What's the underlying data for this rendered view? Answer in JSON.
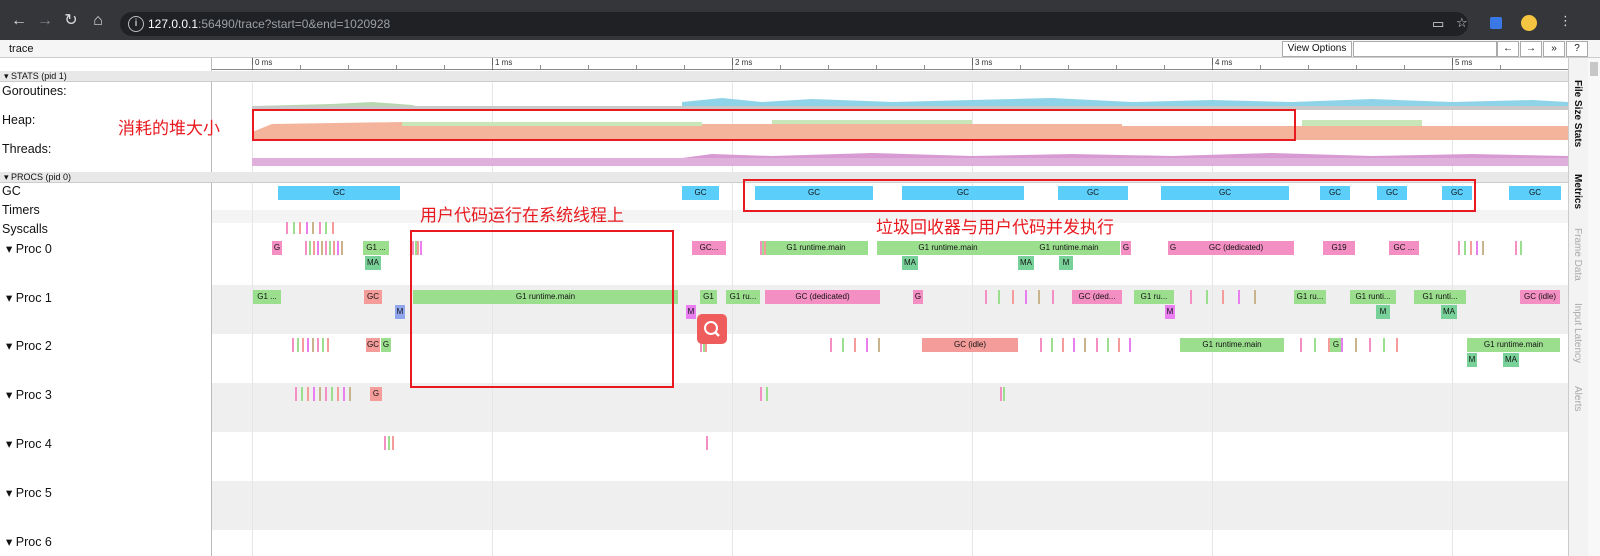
{
  "browser": {
    "url_host": "127.0.0.1",
    "url_rest": ":56490/trace?start=0&end=1020928",
    "nav_icons": [
      "back-arrow-icon",
      "forward-arrow-icon",
      "reload-icon",
      "home-icon"
    ]
  },
  "toolbar": {
    "title": "trace",
    "view_options": "View Options",
    "search_placeholder": "",
    "nav_prev": "←",
    "nav_next": "→",
    "nav_more": "»",
    "help": "?"
  },
  "ruler": {
    "labels": [
      "0 ms",
      "1 ms",
      "2 ms",
      "3 ms",
      "4 ms",
      "5 ms"
    ]
  },
  "sections": {
    "stats": "STATS (pid 1)",
    "procs": "PROCS (pid 0)"
  },
  "tracks": {
    "goroutines": "Goroutines:",
    "heap": "Heap:",
    "threads": "Threads:",
    "gc": "GC",
    "timers": "Timers",
    "syscalls": "Syscalls",
    "proc0": "Proc 0",
    "proc1": "Proc 1",
    "proc2": "Proc 2",
    "proc3": "Proc 3",
    "proc4": "Proc 4",
    "proc5": "Proc 5",
    "proc6": "Proc 6"
  },
  "slices": {
    "gc": [
      "GC",
      "GC",
      "GC",
      "GC",
      "GC",
      "GC",
      "GC",
      "GC",
      "GC",
      "GC"
    ],
    "p0": [
      "G",
      "G1 ...",
      "MA",
      "GC...",
      "G1 runtime.main",
      "G1 runtime.main",
      "MA",
      "G1 runtime.main",
      "MA",
      "M",
      "G",
      "G",
      "GC (dedicated)",
      "G19",
      "GC ..."
    ],
    "p1": [
      "G1 ...",
      "GC",
      "M",
      "G1 runtime.main",
      "M",
      "G1",
      "G1 ru...",
      "GC (dedicated)",
      "G",
      "GC (ded...",
      "G1 ru...",
      "M",
      "G1 ru...",
      "G1 runti...",
      "M",
      "G1 runti...",
      "MA",
      "GC (idle)"
    ],
    "p2": [
      "GC",
      "G",
      "GC (idle)",
      "G1 runtime.main",
      "G",
      "G1 runtime.main",
      "M",
      "MA"
    ],
    "p3": [
      "G"
    ]
  },
  "annotations": {
    "heap": "消耗的堆大小",
    "user_code": "用户代码运行在系统线程上",
    "gc_concurrent": "垃圾回收器与用户代码并发执行"
  },
  "side_tabs": [
    "File Size Stats",
    "Metrics",
    "Frame Data",
    "Input Latency",
    "Alerts"
  ],
  "colors": {
    "gc_blue": "#5bcefa",
    "runtime_green": "#9bde8e",
    "gc_pink": "#f48fc3",
    "heap_salmon": "#f4b49c",
    "annotation_red": "#e8191f"
  }
}
